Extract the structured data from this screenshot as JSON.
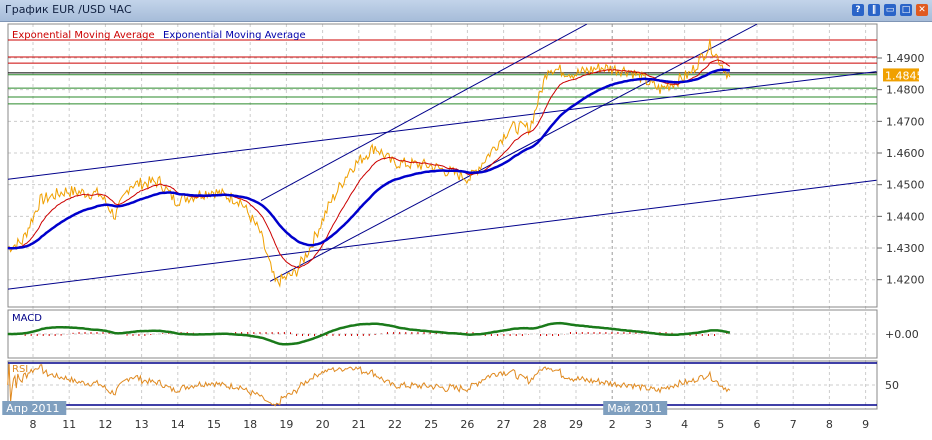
{
  "window": {
    "title": "График EUR /USD  ЧАС",
    "buttons": [
      "?",
      "‖",
      "▭",
      "□",
      "✕"
    ]
  },
  "chart_data": {
    "type": "line",
    "title": "График EUR /USD  ЧАС",
    "legend": [
      "Exponential  Moving  Average",
      "Exponential  Moving  Average"
    ],
    "legend_colors": [
      "#cc0000",
      "#0000aa"
    ],
    "current_price": "1.4845",
    "y_ticks": [
      "1.4900",
      "1.4800",
      "1.4700",
      "1.4600",
      "1.4500",
      "1.4400",
      "1.4300",
      "1.4200"
    ],
    "y_tick_values": [
      1.49,
      1.48,
      1.47,
      1.46,
      1.45,
      1.44,
      1.43,
      1.42
    ],
    "ylim": [
      1.412,
      1.5007
    ],
    "x_ticks": [
      "8",
      "11",
      "12",
      "13",
      "14",
      "15",
      "18",
      "19",
      "20",
      "21",
      "22",
      "25",
      "26",
      "27",
      "28",
      "29",
      "2",
      "3",
      "4",
      "5",
      "6",
      "7",
      "8",
      "9"
    ],
    "months": [
      {
        "label": "Апр 2011",
        "at": -0.6
      },
      {
        "label": "Май 2011",
        "at": 16
      }
    ],
    "price_anchors": [
      [
        -0.7,
        1.43
      ],
      [
        -0.3,
        1.432
      ],
      [
        0.2,
        1.445
      ],
      [
        0.9,
        1.448
      ],
      [
        1.85,
        1.447
      ],
      [
        2.27,
        1.44
      ],
      [
        2.68,
        1.45
      ],
      [
        3.5,
        1.451
      ],
      [
        3.92,
        1.445
      ],
      [
        4.94,
        1.448
      ],
      [
        5.72,
        1.445
      ],
      [
        6.27,
        1.435
      ],
      [
        6.69,
        1.419
      ],
      [
        7.24,
        1.422
      ],
      [
        7.65,
        1.43
      ],
      [
        8.2,
        1.444
      ],
      [
        8.76,
        1.455
      ],
      [
        9.45,
        1.462
      ],
      [
        9.92,
        1.457
      ],
      [
        10.97,
        1.456
      ],
      [
        12.07,
        1.452
      ],
      [
        12.62,
        1.46
      ],
      [
        13.18,
        1.468
      ],
      [
        13.73,
        1.468
      ],
      [
        14.23,
        1.487
      ],
      [
        14.97,
        1.485
      ],
      [
        15.66,
        1.487
      ],
      [
        16.49,
        1.486
      ],
      [
        17.32,
        1.48
      ],
      [
        18.15,
        1.485
      ],
      [
        18.7,
        1.494
      ],
      [
        19.25,
        1.484
      ]
    ],
    "horizontal_levels": [
      {
        "v": 1.4957,
        "c": "#cc0000"
      },
      {
        "v": 1.4903,
        "c": "#cc0000"
      },
      {
        "v": 1.4884,
        "c": "#cc0000"
      },
      {
        "v": 1.4853,
        "c": "#000000"
      },
      {
        "v": 1.4847,
        "c": "#2a8a2a"
      },
      {
        "v": 1.4805,
        "c": "#2a8a2a"
      },
      {
        "v": 1.4777,
        "c": "#2a8a2a"
      },
      {
        "v": 1.4755,
        "c": "#2a8a2a"
      }
    ],
    "trendlines": [
      [
        [
          -0.7,
          1.4517
        ],
        [
          23.3,
          1.4857
        ]
      ],
      [
        [
          -0.7,
          1.417
        ],
        [
          23.3,
          1.4514
        ]
      ],
      [
        [
          6.3,
          1.445
        ],
        [
          15.3,
          1.5007
        ]
      ],
      [
        [
          6.55,
          1.4195
        ],
        [
          20.0,
          1.5007
        ]
      ]
    ],
    "indicators": {
      "macd_label": "MACD",
      "macd_tick": "+0.00",
      "rsi_label": "RSI",
      "rsi_tick": "50"
    },
    "colors": {
      "price": "#f0a000",
      "ema_fast": "#cc0000",
      "ema_slow": "#0000cc",
      "macd": "#1a7a1a",
      "rsi": "#e08a20",
      "current": "#f0a000"
    }
  }
}
